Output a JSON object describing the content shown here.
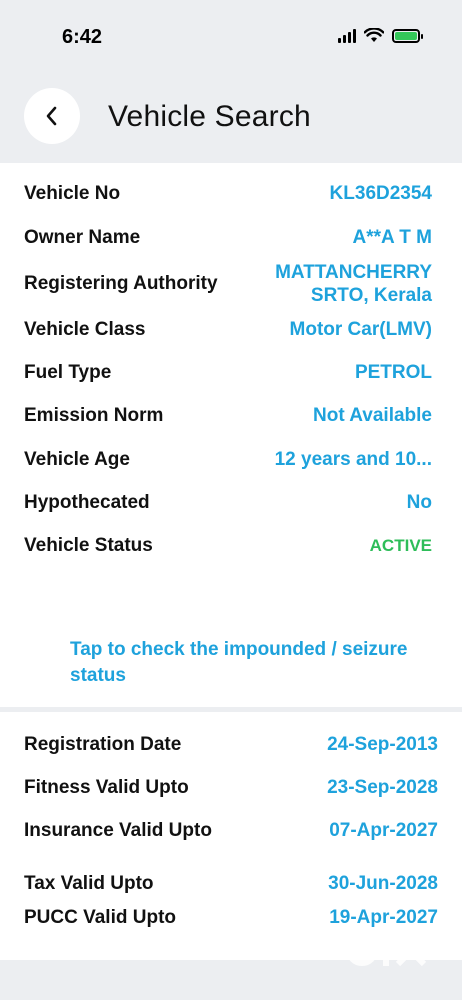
{
  "status_bar": {
    "time": "6:42"
  },
  "header": {
    "title": "Vehicle Search"
  },
  "vehicle_details": [
    {
      "label": "Vehicle No",
      "value": "KL36D2354"
    },
    {
      "label": "Owner Name",
      "value": "A**A T M"
    },
    {
      "label": "Registering Authority",
      "value": "MATTANCHERRY SRTO, Kerala"
    },
    {
      "label": "Vehicle Class",
      "value": "Motor Car(LMV)"
    },
    {
      "label": "Fuel Type",
      "value": "PETROL"
    },
    {
      "label": "Emission Norm",
      "value": "Not Available"
    },
    {
      "label": "Vehicle Age",
      "value": "12 years and 10..."
    },
    {
      "label": "Hypothecated",
      "value": "No"
    },
    {
      "label": "Vehicle Status",
      "value": "ACTIVE"
    }
  ],
  "impound_link": "Tap to check the impounded / seizure status",
  "validity": [
    {
      "label": "Registration Date",
      "value": "24-Sep-2013"
    },
    {
      "label": "Fitness Valid Upto",
      "value": "23-Sep-2028"
    },
    {
      "label": "Insurance Valid Upto",
      "value": "07-Apr-2027"
    },
    {
      "label": "Tax Valid Upto",
      "value": "30-Jun-2028"
    },
    {
      "label": "PUCC Valid Upto",
      "value": "19-Apr-2027"
    }
  ],
  "icons": {
    "back": "chevron-left-icon",
    "signal": "cellular-signal-icon",
    "wifi": "wifi-icon",
    "battery": "battery-charging-icon",
    "watermark": "olx-watermark"
  },
  "colors": {
    "accent": "#1ea2dc",
    "status_active": "#2ebd59",
    "background": "#eceef1",
    "card": "#ffffff"
  }
}
